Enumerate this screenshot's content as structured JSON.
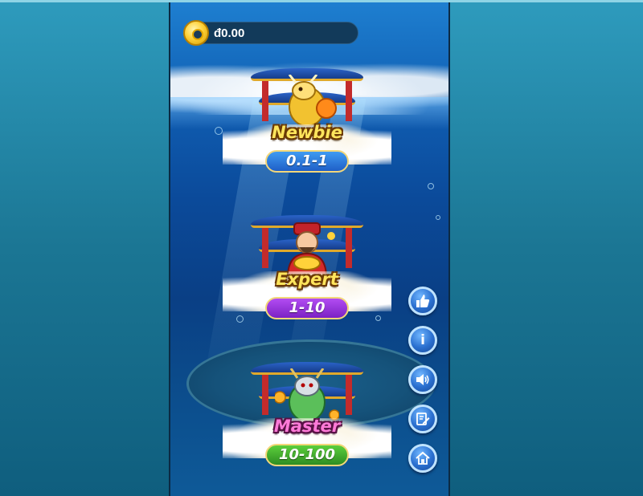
{
  "balance": {
    "currency": "đ",
    "amount_text": "0.00",
    "icon": "coin-icon"
  },
  "rooms": [
    {
      "name": "Newbie",
      "range": "0.1-1",
      "mascot": "golden-dragon",
      "range_color": "#2f7fe0"
    },
    {
      "name": "Expert",
      "range": "1-10",
      "mascot": "fortune-god",
      "range_color": "#9a35dc"
    },
    {
      "name": "Master",
      "range": "10-100",
      "mascot": "jade-dragon",
      "range_color": "#45ad2e"
    }
  ],
  "side_buttons": [
    {
      "icon": "thumbs-up-icon"
    },
    {
      "icon": "info-icon",
      "glyph": "i"
    },
    {
      "icon": "sound-icon"
    },
    {
      "icon": "edit-icon"
    },
    {
      "icon": "home-icon"
    }
  ],
  "colors": {
    "title_gold": "#ffe55c",
    "title_pink": "#ff7ad8",
    "button_blue": "#2a6fcf"
  }
}
